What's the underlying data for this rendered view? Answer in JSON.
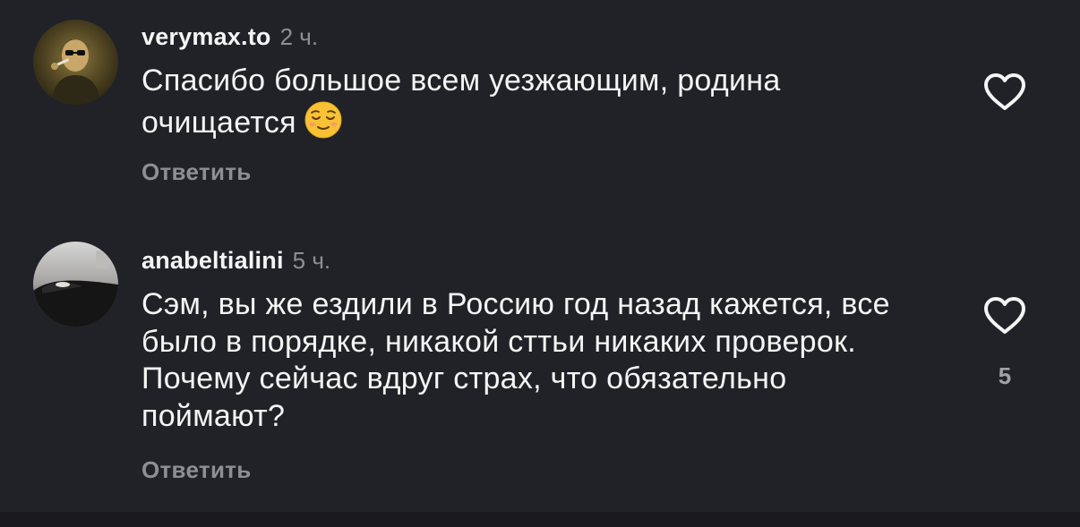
{
  "comments": [
    {
      "username": "verymax.to",
      "time": "2 ч.",
      "text": "Спасибо большое всем уезжающим, родина очищается",
      "emoji": "relieved-face",
      "reply_label": "Ответить",
      "likes": ""
    },
    {
      "username": "anabeltialini",
      "time": "5 ч.",
      "text": "Сэм, вы же ездили в Россию год назад кажется, все было в порядке, никакой сттьи никаких проверок. Почему сейчас вдруг страх, что обязательно поймают?",
      "reply_label": "Ответить",
      "likes": "5"
    }
  ],
  "colors": {
    "background": "#212227",
    "text_primary": "#f5f5f5",
    "text_secondary": "#8e8e93",
    "heart_outline": "#f5f5f5",
    "emoji_fill": "#f9c234"
  },
  "icons": [
    "heart-outline-icon",
    "relieved-face-emoji"
  ]
}
